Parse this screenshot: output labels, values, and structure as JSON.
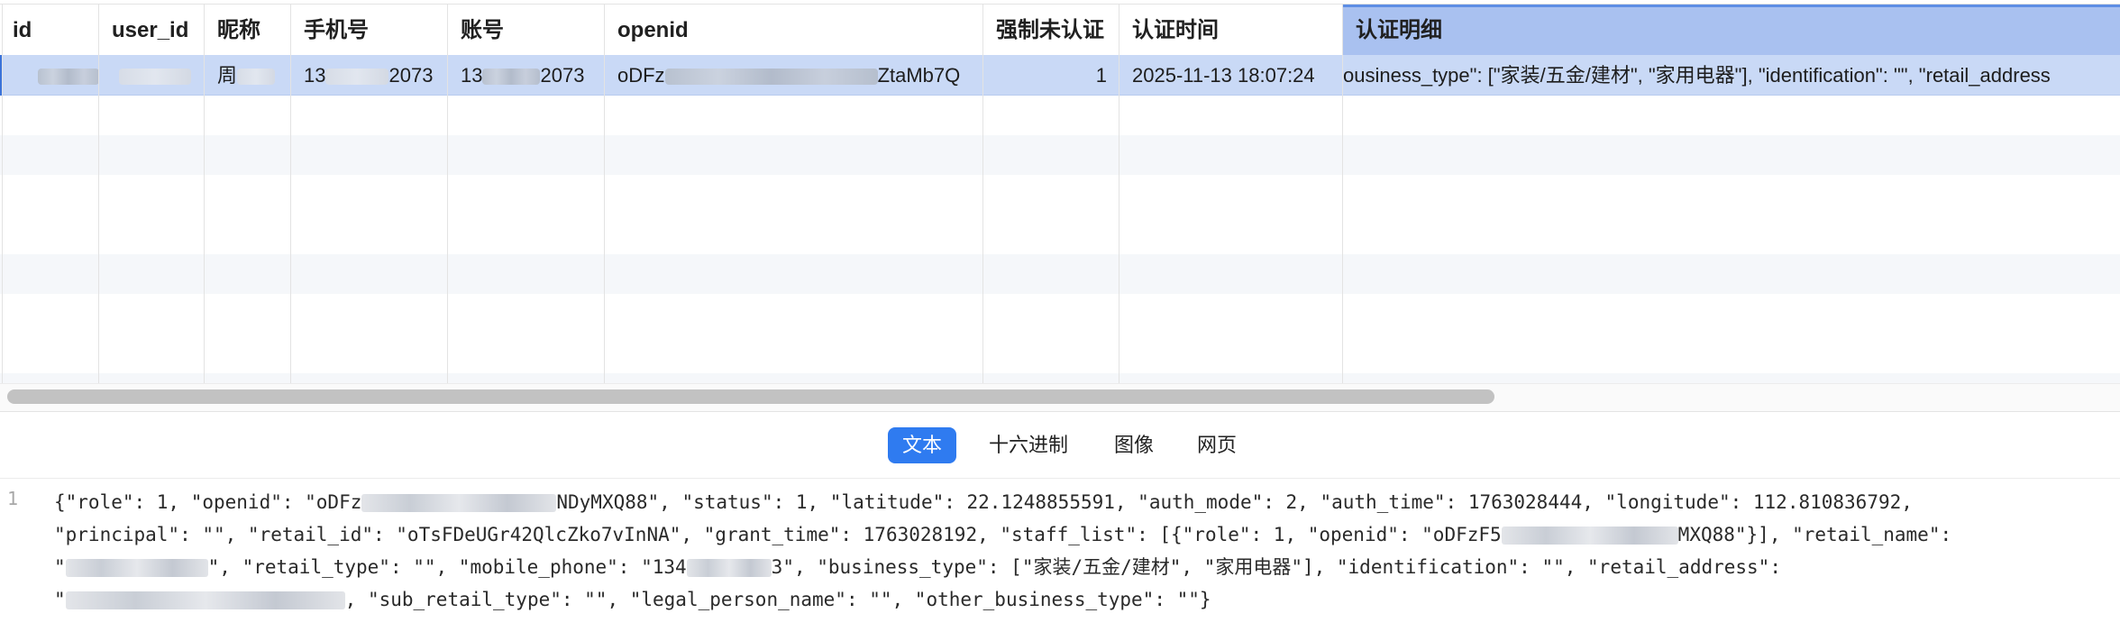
{
  "columns": [
    "id",
    "user_id",
    "昵称",
    "手机号",
    "账号",
    "openid",
    "强制未认证",
    "认证时间",
    "认证明细"
  ],
  "row": {
    "nickname_prefix": "周",
    "phone_prefix": "13",
    "phone_suffix": "2073",
    "account_prefix": "13",
    "account_suffix": "2073",
    "openid_prefix": "oDFz",
    "openid_suffix": "ZtaMb7Q",
    "force_unverified": "1",
    "auth_time": "2025-11-13 18:07:24",
    "detail": "ousiness_type\": [\"家装/五金/建材\", \"家用电器\"], \"identification\": \"\", \"retail_address"
  },
  "tabs": [
    "文本",
    "十六进制",
    "图像",
    "网页"
  ],
  "active_tab": "文本",
  "line_number": "1",
  "json_lines": {
    "l1a": "{\"role\": 1, \"openid\": \"oDFz",
    "l1b": "NDyMXQ88\", \"status\": 1, \"latitude\": 22.1248855591, \"auth_mode\": 2, \"auth_time\": 1763028444, \"longitude\": 112.810836792,",
    "l2a": "\"principal\": \"\", \"retail_id\": \"oTsFDeUGr42QlcZko7vInNA\", \"grant_time\": 1763028192, \"staff_list\": [{\"role\": 1, \"openid\": \"oDFzF5",
    "l2b": "MXQ88\"}], \"retail_name\":",
    "l3a": "\"",
    "l3b": "\", \"retail_type\": \"\", \"mobile_phone\": \"134",
    "l3c": "3\", \"business_type\": [\"家装/五金/建材\", \"家用电器\"], \"identification\": \"\", \"retail_address\":",
    "l4a": "\"",
    "l4b": ", \"sub_retail_type\": \"\", \"legal_person_name\": \"\", \"other_business_type\": \"\"}"
  },
  "colors": {
    "selected_row": "#c9d9f6",
    "selected_header": "#a9c1f0",
    "active_tab": "#2f7bf0"
  }
}
